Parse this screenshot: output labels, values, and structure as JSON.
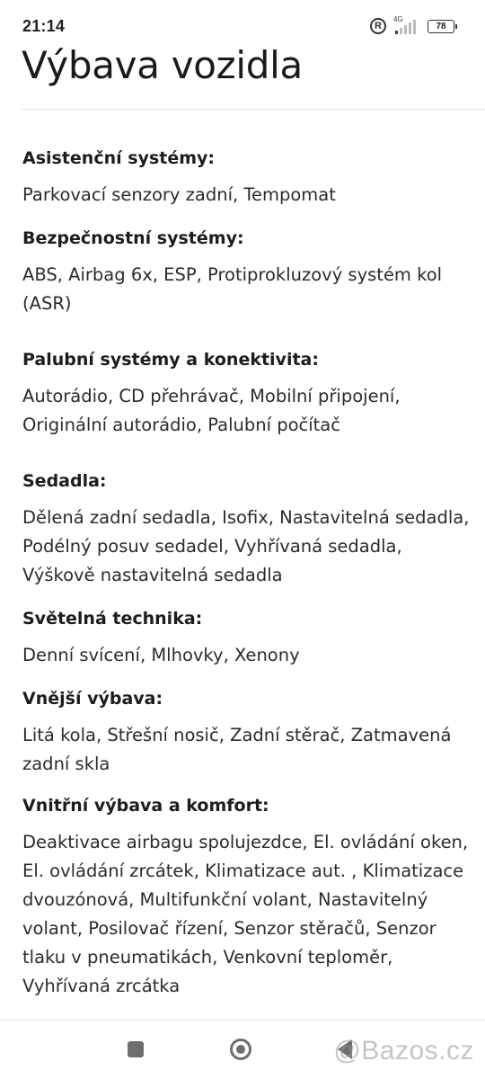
{
  "status_bar": {
    "time": "21:14",
    "signal_tag": "4G",
    "battery": "78"
  },
  "page": {
    "title": "Výbava vozidla"
  },
  "sections": [
    {
      "heading": "Asistenční systémy:",
      "value": "Parkovací senzory zadní, Tempomat"
    },
    {
      "heading": "Bezpečnostní systémy:",
      "value": "ABS, Airbag 6x, ESP, Protiprokluzový systém kol (ASR)"
    },
    {
      "heading": "Palubní systémy a konektivita:",
      "value": "Autorádio, CD přehrávač, Mobilní připojení, Originální autorádio, Palubní počítač"
    },
    {
      "heading": "Sedadla:",
      "value": "Dělená zadní sedadla, Isofix, Nastavitelná sedadla, Podélný posuv sedadel, Vyhřívaná sedadla, Výškově nastavitelná sedadla"
    },
    {
      "heading": "Světelná technika:",
      "value": "Denní svícení, Mlhovky, Xenony"
    },
    {
      "heading": "Vnější výbava:",
      "value": "Litá kola, Střešní nosič, Zadní stěrač, Zatmavená zadní skla"
    },
    {
      "heading": "Vnitřní výbava a komfort:",
      "value": "Deaktivace airbagu spolujezdce, El. ovládání oken, El. ovládání zrcátek, Klimatizace aut. , Klimatizace dvouzónová, Multifunkční volant, Nastavitelný volant, Posilovač řízení, Senzor stěračů, Senzor tlaku v pneumatikách, Venkovní teploměr, Vyhřívaná zrcátka"
    }
  ],
  "watermark": "@Bazos.cz",
  "icons": {
    "registered": "R",
    "recents": "square-icon",
    "home": "circle-icon",
    "back": "triangle-icon"
  }
}
